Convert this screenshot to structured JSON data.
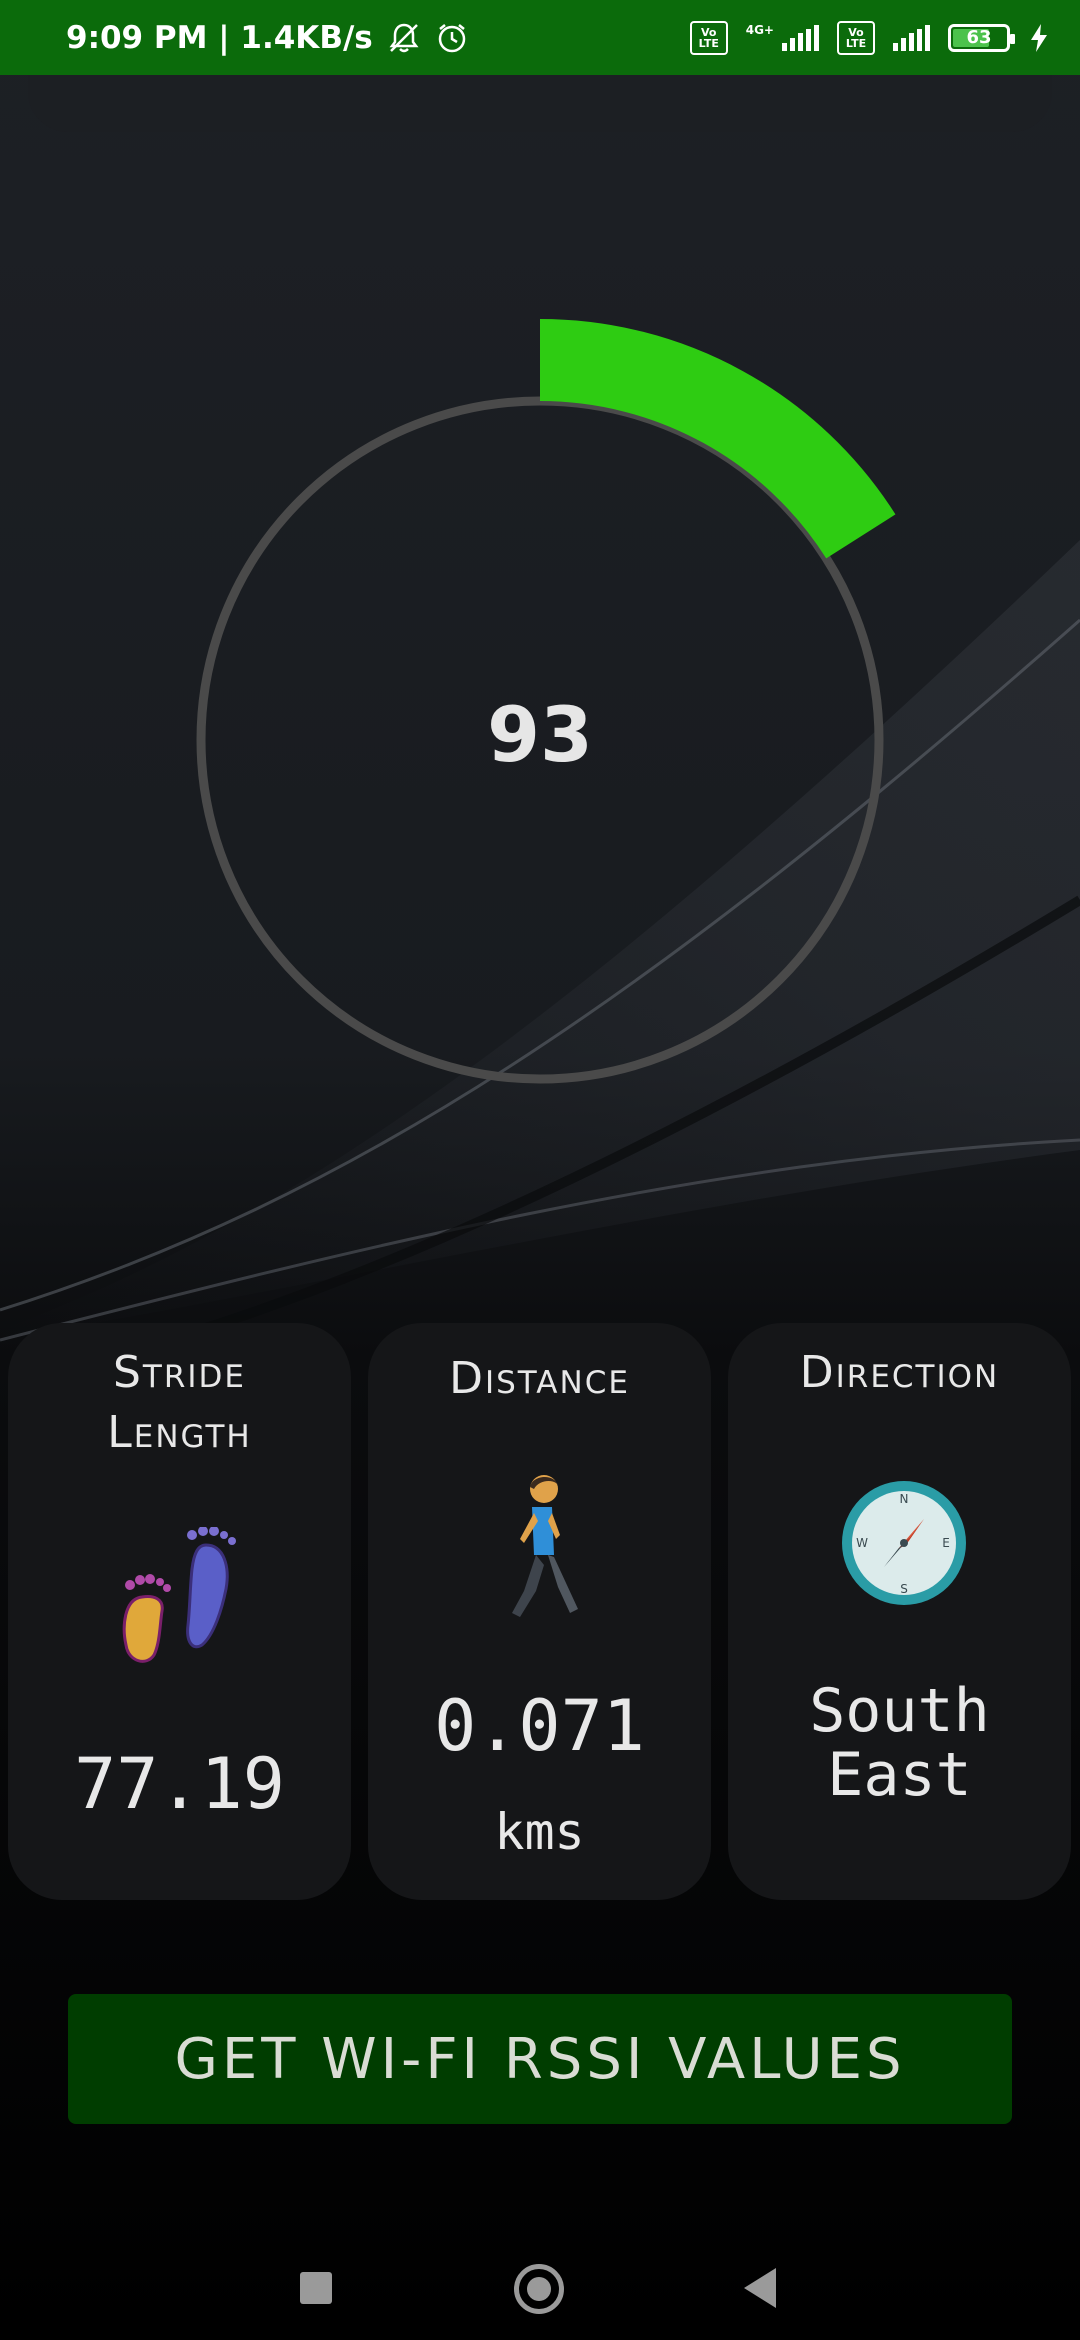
{
  "status_bar": {
    "time_speed": "9:09 PM | 1.4KB/s",
    "net_type": "4G+",
    "lte_badge": "Vo LTE",
    "battery": "63",
    "icons": [
      "silent-bell-icon",
      "alarm-icon",
      "volte-icon",
      "signal-icon",
      "battery-icon",
      "charging-icon"
    ]
  },
  "gauge": {
    "value": "93",
    "fraction": 0.16,
    "colors": {
      "track": "#4a4a4a",
      "progress": "#2ecc12"
    }
  },
  "cards": {
    "stride": {
      "title_line1": "Stride",
      "title_line2": "Length",
      "value": "77.19",
      "icon": "footprints-icon"
    },
    "distance": {
      "title": "Distance",
      "value": "0.071",
      "unit": "kms",
      "icon": "walking-person-icon"
    },
    "direction": {
      "title": "Direction",
      "value_line1": "South",
      "value_line2": "East",
      "icon": "compass-icon"
    }
  },
  "button": {
    "label": "GET WI-FI RSSI VALUES"
  },
  "nav": {
    "icons": [
      "recents-icon",
      "home-icon",
      "back-icon"
    ]
  }
}
